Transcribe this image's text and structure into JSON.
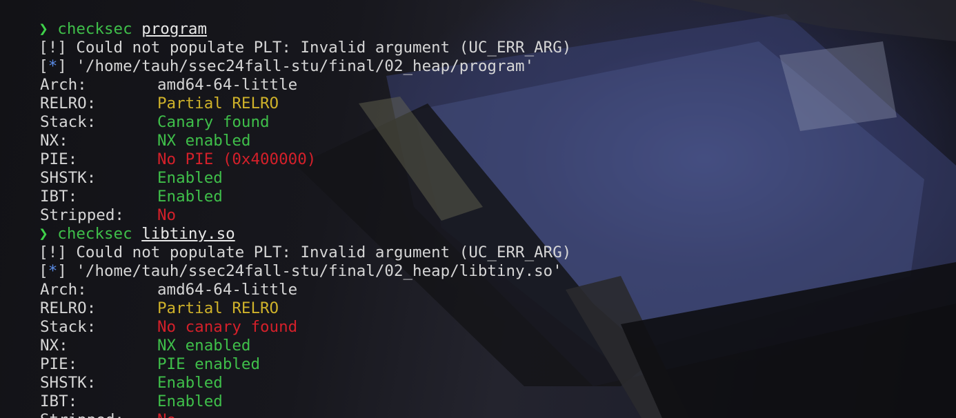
{
  "colors": {
    "prompt": "#3fd14a",
    "green": "#3fbf4a",
    "yellow": "#cfb22a",
    "red": "#d4202a",
    "info": "#5b8de8",
    "text": "#d6d6d6"
  },
  "sessions": [
    {
      "prompt_symbol": "❯",
      "command": "checksec",
      "argument": "program",
      "warning_mark": "!",
      "warning_text": "Could not populate PLT: Invalid argument (UC_ERR_ARG)",
      "info_mark": "*",
      "path": "'/home/tauh/ssec24fall-stu/final/02_heap/program'",
      "props": [
        {
          "key": "Arch:",
          "value": "amd64-64-little",
          "color": "white"
        },
        {
          "key": "RELRO:",
          "value": "Partial RELRO",
          "color": "yellow"
        },
        {
          "key": "Stack:",
          "value": "Canary found",
          "color": "green"
        },
        {
          "key": "NX:",
          "value": "NX enabled",
          "color": "green"
        },
        {
          "key": "PIE:",
          "value": "No PIE (0x400000)",
          "color": "red"
        },
        {
          "key": "SHSTK:",
          "value": "Enabled",
          "color": "green"
        },
        {
          "key": "IBT:",
          "value": "Enabled",
          "color": "green"
        },
        {
          "key": "Stripped:",
          "value": "No",
          "color": "red"
        }
      ]
    },
    {
      "prompt_symbol": "❯",
      "command": "checksec",
      "argument": "libtiny.so",
      "warning_mark": "!",
      "warning_text": "Could not populate PLT: Invalid argument (UC_ERR_ARG)",
      "info_mark": "*",
      "path": "'/home/tauh/ssec24fall-stu/final/02_heap/libtiny.so'",
      "props": [
        {
          "key": "Arch:",
          "value": "amd64-64-little",
          "color": "white"
        },
        {
          "key": "RELRO:",
          "value": "Partial RELRO",
          "color": "yellow"
        },
        {
          "key": "Stack:",
          "value": "No canary found",
          "color": "red"
        },
        {
          "key": "NX:",
          "value": "NX enabled",
          "color": "green"
        },
        {
          "key": "PIE:",
          "value": "PIE enabled",
          "color": "green"
        },
        {
          "key": "SHSTK:",
          "value": "Enabled",
          "color": "green"
        },
        {
          "key": "IBT:",
          "value": "Enabled",
          "color": "green"
        },
        {
          "key": "Stripped:",
          "value": "No",
          "color": "red"
        }
      ]
    }
  ]
}
